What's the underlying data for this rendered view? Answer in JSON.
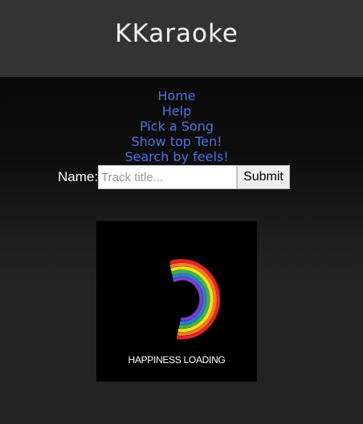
{
  "header": {
    "title": "KKaraoke"
  },
  "nav": {
    "items": [
      {
        "label": "Home"
      },
      {
        "label": "Help"
      },
      {
        "label": "Pick a Song"
      },
      {
        "label": "Show top Ten!"
      },
      {
        "label": "Search by feels!"
      }
    ]
  },
  "search": {
    "label": "Name:",
    "placeholder": "Track title...",
    "value": "",
    "submit_label": "Submit"
  },
  "loader": {
    "text": "HAPPINESS LOADING",
    "icon": "rainbow-arc-icon"
  },
  "colors": {
    "header_bg": "#333333",
    "link": "#4a72e6",
    "body_bg": "#232323",
    "rainbow": [
      "#e8232b",
      "#f47b20",
      "#f5e11a",
      "#3cb44b",
      "#2f7bd6",
      "#7a3fd1"
    ]
  }
}
